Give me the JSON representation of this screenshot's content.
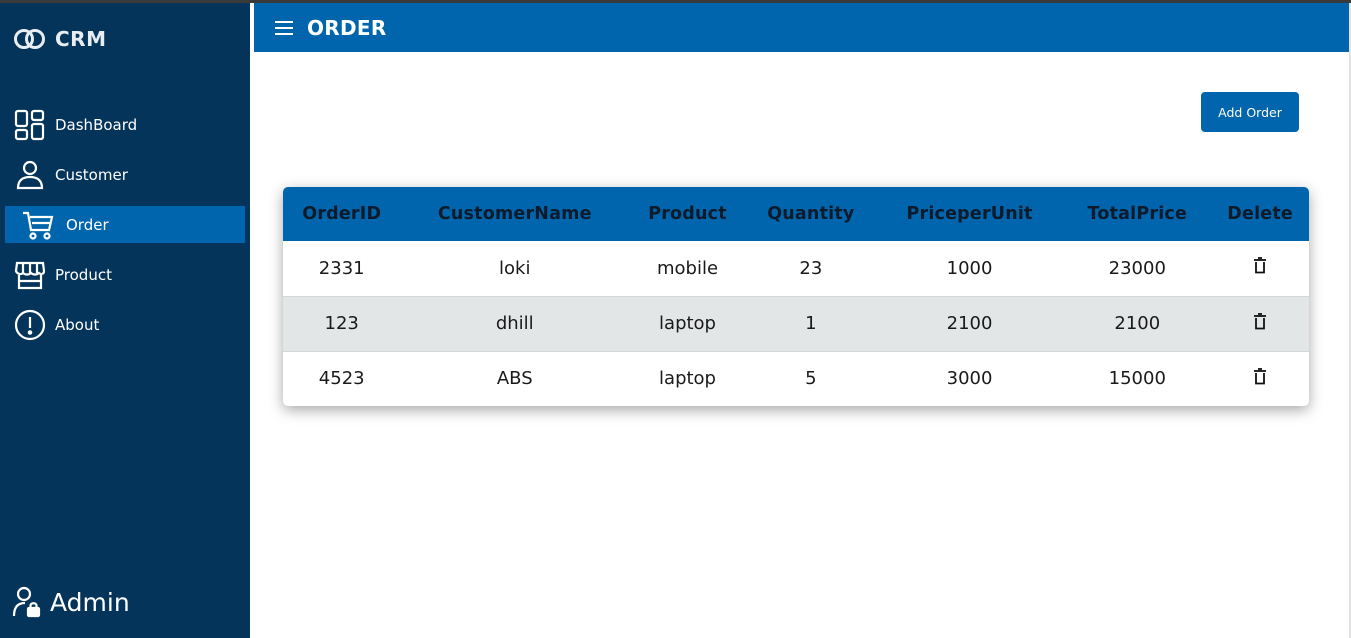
{
  "app": {
    "brand": "CRM"
  },
  "sidebar": {
    "items": [
      {
        "label": "DashBoard",
        "icon": "dashboard-icon"
      },
      {
        "label": "Customer",
        "icon": "user-icon"
      },
      {
        "label": "Order",
        "icon": "cart-icon",
        "active": true
      },
      {
        "label": "Product",
        "icon": "store-icon"
      },
      {
        "label": "About",
        "icon": "info-icon"
      }
    ],
    "user": {
      "label": "Admin",
      "icon": "user-lock-icon"
    }
  },
  "header": {
    "title": "ORDER",
    "menu_icon": "hamburger-icon"
  },
  "toolbar": {
    "add_label": "Add Order"
  },
  "table": {
    "columns": [
      "OrderID",
      "CustomerName",
      "Product",
      "Quantity",
      "PriceperUnit",
      "TotalPrice",
      "Delete"
    ],
    "rows": [
      {
        "order_id": "2331",
        "customer": "loki",
        "product": "mobile",
        "quantity": "23",
        "price": "1000",
        "total": "23000"
      },
      {
        "order_id": "123",
        "customer": "dhill",
        "product": "laptop",
        "quantity": "1",
        "price": "2100",
        "total": "2100"
      },
      {
        "order_id": "4523",
        "customer": "ABS",
        "product": "laptop",
        "quantity": "5",
        "price": "3000",
        "total": "15000"
      }
    ],
    "delete_icon": "trash-icon"
  },
  "colors": {
    "sidebar": "#04345a",
    "accent": "#0165ad",
    "row_alt": "#e3e6e7"
  }
}
